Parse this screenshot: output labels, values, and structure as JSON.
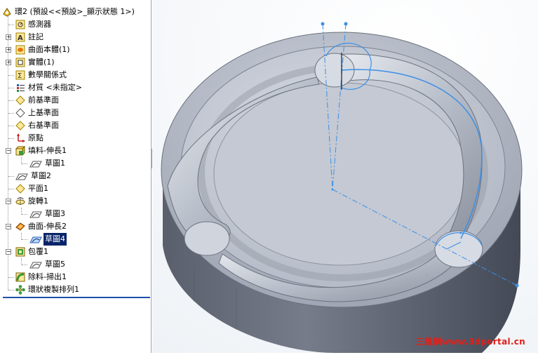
{
  "tree": {
    "root": "環2  (預設<<預設>_顯示狀態 1>)",
    "items": [
      {
        "label": "感測器"
      },
      {
        "label": "註記"
      },
      {
        "label": "曲面本體(1)"
      },
      {
        "label": "實體(1)"
      },
      {
        "label": "數學關係式"
      },
      {
        "label": "材質 <未指定>"
      },
      {
        "label": "前基準面"
      },
      {
        "label": "上基準面"
      },
      {
        "label": "右基準面"
      },
      {
        "label": "原點"
      },
      {
        "label": "填料-伸長1"
      },
      {
        "label": "草圖1"
      },
      {
        "label": "草圖2"
      },
      {
        "label": "平面1"
      },
      {
        "label": "旋轉1"
      },
      {
        "label": "草圖3"
      },
      {
        "label": "曲面-伸長2"
      },
      {
        "label": "草圖4"
      },
      {
        "label": "包覆1"
      },
      {
        "label": "草圖5"
      },
      {
        "label": "除料-掃出1"
      },
      {
        "label": "環狀複製排列1"
      }
    ]
  },
  "watermark": "三維網www.3dportal.cn",
  "colors": {
    "accent": "#0a246a",
    "sketch": "#3c8fe6",
    "part": "#a8aeba"
  }
}
